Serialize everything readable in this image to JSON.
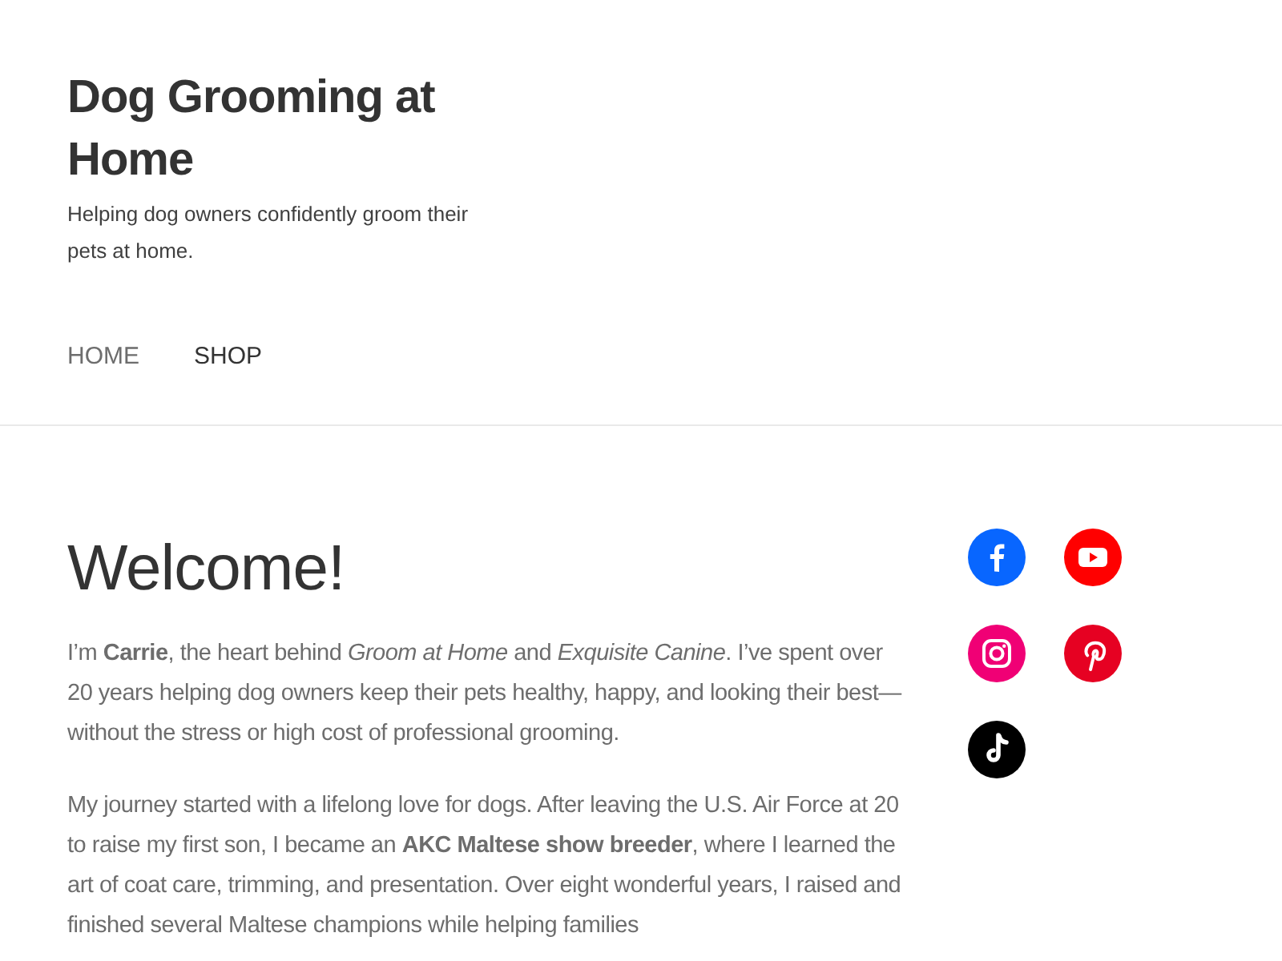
{
  "site": {
    "title": "Dog Grooming at Home",
    "tagline": "Helping dog owners confidently groom their pets at home."
  },
  "nav": [
    {
      "label": "HOME",
      "selected": false
    },
    {
      "label": "SHOP",
      "selected": true
    }
  ],
  "content": {
    "heading": "Welcome!",
    "paragraphs": [
      "I’m **Carrie**, the heart behind *Groom at Home* and *Exquisite Canine*. I’ve spent over 20 years helping dog owners keep their pets healthy, happy, and looking their best—without the stress or high cost of professional grooming.",
      "My journey started with a lifelong love for dogs. After leaving the U.S. Air Force at 20 to raise my first son, I became an **AKC Maltese show breeder**, where I learned the art of coat care, trimming, and presentation. Over eight wonderful years, I raised and finished several Maltese champions while helping families"
    ]
  },
  "social": [
    {
      "kind": "facebook",
      "color": "#0866ff"
    },
    {
      "kind": "youtube",
      "color": "#ff0000"
    },
    {
      "kind": "instagram",
      "color": "#f00075"
    },
    {
      "kind": "pinterest",
      "color": "#e60122"
    },
    {
      "kind": "tiktok",
      "color": "#000000"
    }
  ]
}
